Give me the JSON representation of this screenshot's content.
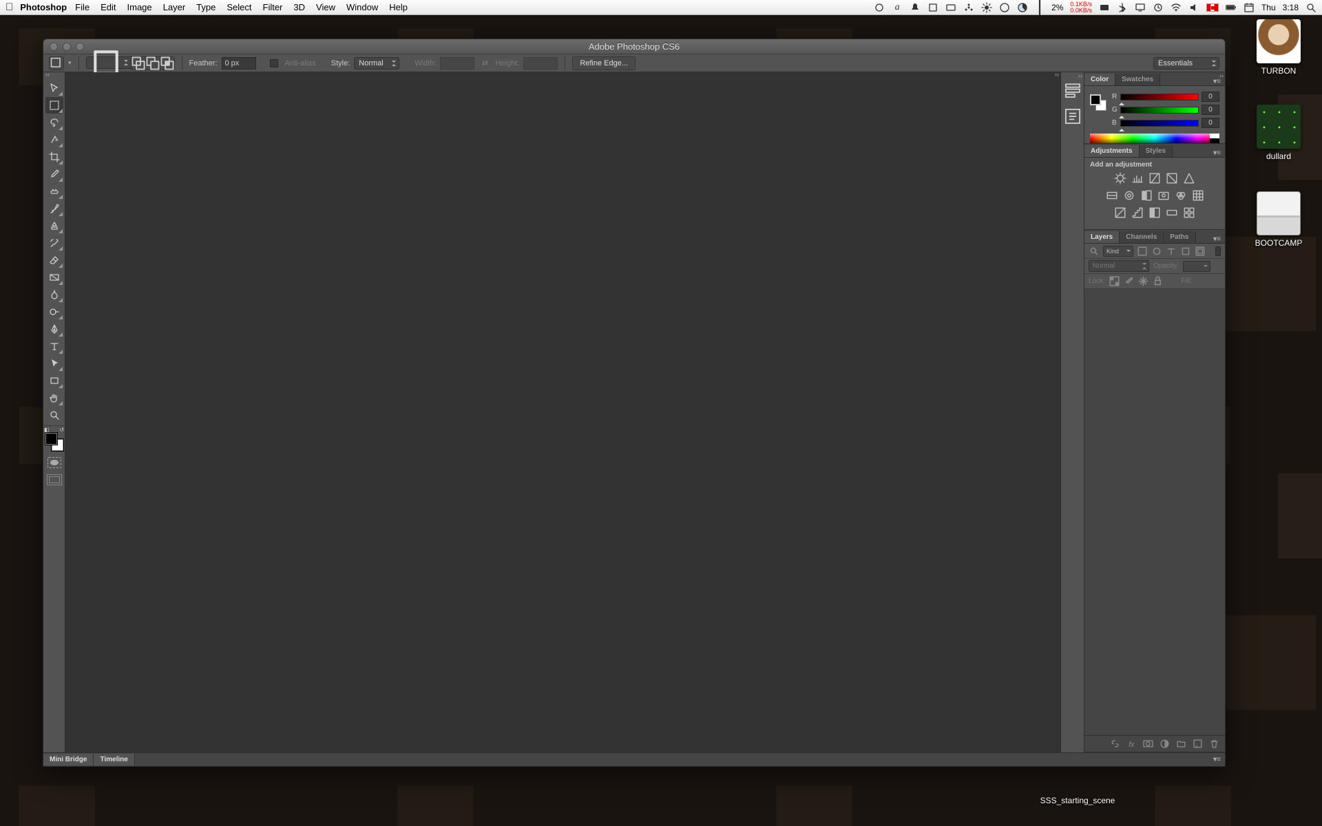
{
  "mac_menu": {
    "app": "Photoshop",
    "items": [
      "File",
      "Edit",
      "Image",
      "Layer",
      "Type",
      "Select",
      "Filter",
      "3D",
      "View",
      "Window",
      "Help"
    ],
    "cpu": "2%",
    "net_up": "0.1KB/s",
    "net_dn": "0.0KB/s",
    "clock_day": "Thu",
    "clock_time": "3:18"
  },
  "desktop": {
    "icon1": "TURBON",
    "icon2": "dullard",
    "icon3": "BOOTCAMP",
    "bottom": "SSS_starting_scene"
  },
  "window": {
    "title": "Adobe Photoshop CS6"
  },
  "optbar": {
    "feather_label": "Feather:",
    "feather_value": "0 px",
    "antialias": "Anti-alias",
    "style_label": "Style:",
    "style_value": "Normal",
    "width_label": "Width:",
    "height_label": "Height:",
    "refine": "Refine Edge...",
    "workspace": "Essentials"
  },
  "color_panel": {
    "tab1": "Color",
    "tab2": "Swatches",
    "r": "R",
    "g": "G",
    "b": "B",
    "rv": "0",
    "gv": "0",
    "bv": "0"
  },
  "adj_panel": {
    "tab1": "Adjustments",
    "tab2": "Styles",
    "label": "Add an adjustment"
  },
  "layers_panel": {
    "tab1": "Layers",
    "tab2": "Channels",
    "tab3": "Paths",
    "filter_kind": "Kind",
    "blend_mode": "Normal",
    "opacity_label": "Opacity:",
    "lock_label": "Lock:",
    "fill_label": "Fill:"
  },
  "bottom": {
    "tab1": "Mini Bridge",
    "tab2": "Timeline"
  }
}
